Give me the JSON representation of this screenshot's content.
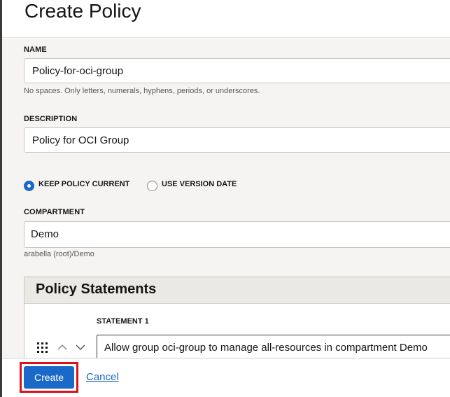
{
  "header": {
    "title": "Create Policy"
  },
  "form": {
    "name": {
      "label": "NAME",
      "value": "Policy-for-oci-group",
      "help": "No spaces. Only letters, numerals, hyphens, periods, or underscores."
    },
    "description": {
      "label": "DESCRIPTION",
      "value": "Policy for OCI Group"
    },
    "versioning": {
      "options": [
        {
          "label": "KEEP POLICY CURRENT",
          "checked": true
        },
        {
          "label": "USE VERSION DATE",
          "checked": false
        }
      ]
    },
    "compartment": {
      "label": "COMPARTMENT",
      "value": "Demo",
      "help": "arabella (root)/Demo"
    },
    "statements": {
      "title": "Policy Statements",
      "items": [
        {
          "label": "STATEMENT 1",
          "value": "Allow group oci-group to manage all-resources in compartment Demo"
        }
      ]
    }
  },
  "footer": {
    "create_label": "Create",
    "cancel_label": "Cancel"
  },
  "colors": {
    "accent": "#1a68c8",
    "highlight": "#d9121b"
  }
}
